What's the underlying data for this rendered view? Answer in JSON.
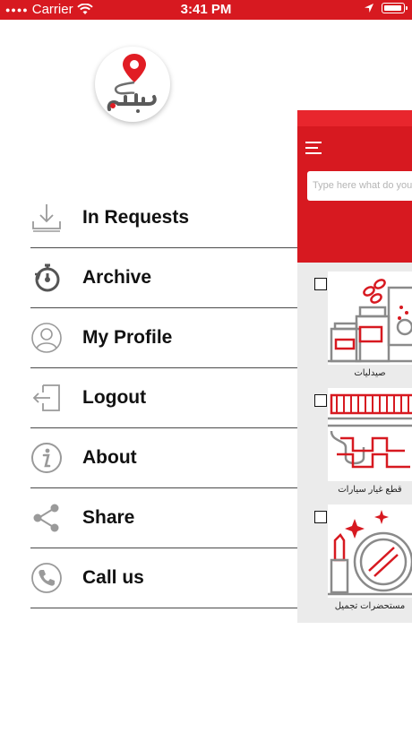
{
  "status_bar": {
    "carrier": "Carrier",
    "time": "3:41 PM"
  },
  "colors": {
    "brand_red": "#d71920",
    "menu_text": "#111111",
    "icon_gray": "#9a9a9a"
  },
  "menu": {
    "items": [
      {
        "label": "In Requests",
        "icon": "download-tray-icon"
      },
      {
        "label": "Archive",
        "icon": "archive-timer-icon"
      },
      {
        "label": "My Profile",
        "icon": "user-circle-icon"
      },
      {
        "label": "Logout",
        "icon": "logout-door-icon"
      },
      {
        "label": "About",
        "icon": "info-icon"
      },
      {
        "label": "Share",
        "icon": "share-icon"
      },
      {
        "label": "Call us",
        "icon": "phone-icon"
      }
    ]
  },
  "main": {
    "search": {
      "placeholder": "Type here what do you want"
    },
    "categories": [
      {
        "label": "صيدليات",
        "icon": "pharmacy-icon"
      },
      {
        "label": "قطع غيار سيارات",
        "icon": "car-parts-icon"
      },
      {
        "label": "مستحضرات تجميل",
        "icon": "cosmetics-icon"
      }
    ]
  }
}
